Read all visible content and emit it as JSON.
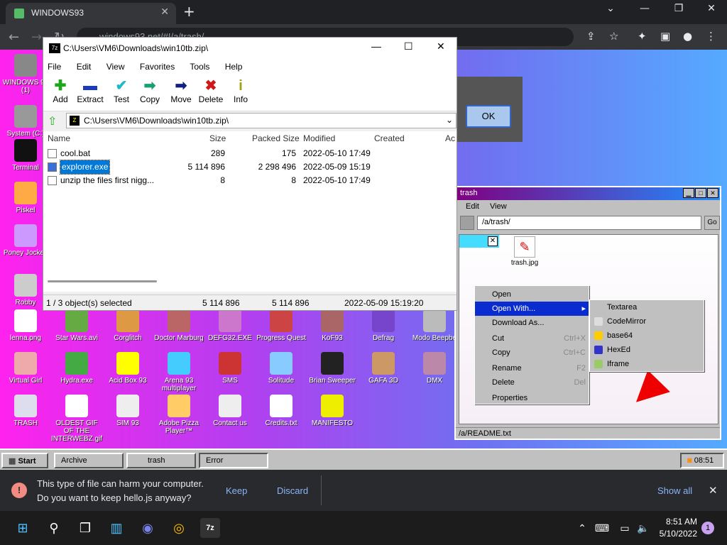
{
  "browser": {
    "tab_title": "WINDOWS93",
    "new_tab": "+",
    "url": "windows93.net/#!/a/trash/",
    "window_controls": [
      "⌄",
      "—",
      "❐",
      "✕"
    ]
  },
  "desktop_icons": [
    {
      "label": "WINDOWS 93 (1)",
      "icon": "computer-icon",
      "color": "#888"
    },
    {
      "label": "System (C:)",
      "icon": "drive-icon",
      "color": "#999"
    },
    {
      "label": "Terminal",
      "icon": "terminal-icon",
      "color": "#111"
    },
    {
      "label": "Piskel",
      "icon": "palette-icon",
      "color": "#fa4"
    },
    {
      "label": "Poney Jockey",
      "icon": "pony-icon",
      "color": "#c9f"
    },
    {
      "label": "Robby",
      "icon": "robot-icon",
      "color": "#ccc"
    },
    {
      "label": "lenna.png",
      "icon": "image-file-icon",
      "color": "#fff"
    },
    {
      "label": "Star Wars.avi",
      "icon": "yoda-icon",
      "color": "#6a4"
    },
    {
      "label": "Corglitch",
      "icon": "dog-icon",
      "color": "#d94"
    },
    {
      "label": "Doctor Marburg",
      "icon": "doctor-icon",
      "color": "#b66"
    },
    {
      "label": "DEFG32.EXE",
      "icon": "monster-icon",
      "color": "#c7c"
    },
    {
      "label": "Progress Quest",
      "icon": "swords-icon",
      "color": "#c44"
    },
    {
      "label": "KoF93",
      "icon": "fighter-icon",
      "color": "#a66"
    },
    {
      "label": "Defrag",
      "icon": "defrag-icon",
      "color": "#74c"
    },
    {
      "label": "Modo Beepbe",
      "icon": "speaker-icon",
      "color": "#bbb"
    },
    {
      "label": "Virtual Girl",
      "icon": "face-icon",
      "color": "#eaa"
    },
    {
      "label": "Hydra.exe",
      "icon": "hydra-icon",
      "color": "#4a4"
    },
    {
      "label": "Acid Box 93",
      "icon": "smiley-icon",
      "color": "#ff0"
    },
    {
      "label": "Arena 93 multiplayer",
      "icon": "cube-icon",
      "color": "#4cf"
    },
    {
      "label": "SMS",
      "icon": "console-icon",
      "color": "#c33"
    },
    {
      "label": "Solitude",
      "icon": "jar-icon",
      "color": "#8cf"
    },
    {
      "label": "Brian Sweeper",
      "icon": "mine-icon",
      "color": "#222"
    },
    {
      "label": "GAFA 3D",
      "icon": "doomguy-icon",
      "color": "#c96"
    },
    {
      "label": "DMX",
      "icon": "box-icon",
      "color": "#b8a"
    },
    {
      "label": "TRASH",
      "icon": "recycle-icon",
      "color": "#dde"
    },
    {
      "label": "OLDEST GIF OF THE INTERWEBZ.gif",
      "icon": "gif-file-icon",
      "color": "#fff"
    },
    {
      "label": "SIM 93",
      "icon": "book-icon",
      "color": "#eee"
    },
    {
      "label": "Adobe Pizza Player™",
      "icon": "pizza-icon",
      "color": "#fc6"
    },
    {
      "label": "Contact us",
      "icon": "mail-icon",
      "color": "#eee"
    },
    {
      "label": "Credits.txt",
      "icon": "text-file-icon",
      "color": "#fff"
    },
    {
      "label": "MANIFESTO",
      "icon": "question-icon",
      "color": "#ee0"
    }
  ],
  "zip_window": {
    "title": "C:\\Users\\VM6\\Downloads\\win10tb.zip\\",
    "menu": [
      "File",
      "Edit",
      "View",
      "Favorites",
      "Tools",
      "Help"
    ],
    "toolbar": [
      {
        "label": "Add",
        "glyph": "✚",
        "color": "#1aa81a"
      },
      {
        "label": "Extract",
        "glyph": "▬",
        "color": "#1a3ac0"
      },
      {
        "label": "Test",
        "glyph": "✔",
        "color": "#20b8c8"
      },
      {
        "label": "Copy",
        "glyph": "➡",
        "color": "#18a070"
      },
      {
        "label": "Move",
        "glyph": "➡",
        "color": "#102080"
      },
      {
        "label": "Delete",
        "glyph": "✖",
        "color": "#d01818"
      },
      {
        "label": "Info",
        "glyph": "i",
        "color": "#a0a010"
      }
    ],
    "address": "C:\\Users\\VM6\\Downloads\\win10tb.zip\\",
    "columns": [
      "Name",
      "Size",
      "Packed Size",
      "Modified",
      "Created",
      "Ac"
    ],
    "rows": [
      {
        "name": "cool.bat",
        "size": "289",
        "packed": "175",
        "modified": "2022-05-10 17:49",
        "selected": false
      },
      {
        "name": "explorer.exe",
        "size": "5 114 896",
        "packed": "2 298 496",
        "modified": "2022-05-09 15:19",
        "selected": true
      },
      {
        "name": "unzip the files first nigg...",
        "size": "8",
        "packed": "8",
        "modified": "2022-05-10 17:49",
        "selected": false
      }
    ],
    "status": {
      "selection": "1 / 3 object(s) selected",
      "size": "5 114 896",
      "packed": "5 114 896",
      "date": "2022-05-09 15:19:20"
    }
  },
  "error_dialog": {
    "ok_label": "OK"
  },
  "trash_window": {
    "title": "trash",
    "menu": [
      "Edit",
      "View"
    ],
    "path": "/a/trash/",
    "go_label": "Go",
    "file": "trash.jpg",
    "footer": "/a/README.txt"
  },
  "context_menu": {
    "items": [
      {
        "label": "Open",
        "shortcut": "",
        "highlight": false
      },
      {
        "label": "Open With...",
        "shortcut": "▸",
        "highlight": true
      },
      {
        "label": "Download As...",
        "shortcut": "",
        "highlight": false
      },
      {
        "label": "Cut",
        "shortcut": "Ctrl+X",
        "highlight": false
      },
      {
        "label": "Copy",
        "shortcut": "Ctrl+C",
        "highlight": false
      },
      {
        "label": "Rename",
        "shortcut": "F2",
        "highlight": false
      },
      {
        "label": "Delete",
        "shortcut": "Del",
        "highlight": false
      },
      {
        "label": "Properties",
        "shortcut": "",
        "highlight": false
      }
    ],
    "submenu": [
      {
        "label": "Textarea",
        "icon": ""
      },
      {
        "label": "CodeMirror",
        "icon": "codemirror-icon"
      },
      {
        "label": "base64",
        "icon": "base64-icon"
      },
      {
        "label": "HexEd",
        "icon": "hexed-icon"
      },
      {
        "label": "Iframe",
        "icon": "iframe-icon"
      }
    ]
  },
  "w93_taskbar": {
    "start": "Start",
    "buttons": [
      "Archive",
      "trash",
      "Error"
    ],
    "clock": "08:51"
  },
  "download_bar": {
    "line1": "This type of file can harm your computer.",
    "line2": "Do you want to keep hello.js anyway?",
    "keep": "Keep",
    "discard": "Discard",
    "show_all": "Show all"
  },
  "win_taskbar": {
    "time": "8:51 AM",
    "date": "5/10/2022",
    "notifications": "1"
  }
}
